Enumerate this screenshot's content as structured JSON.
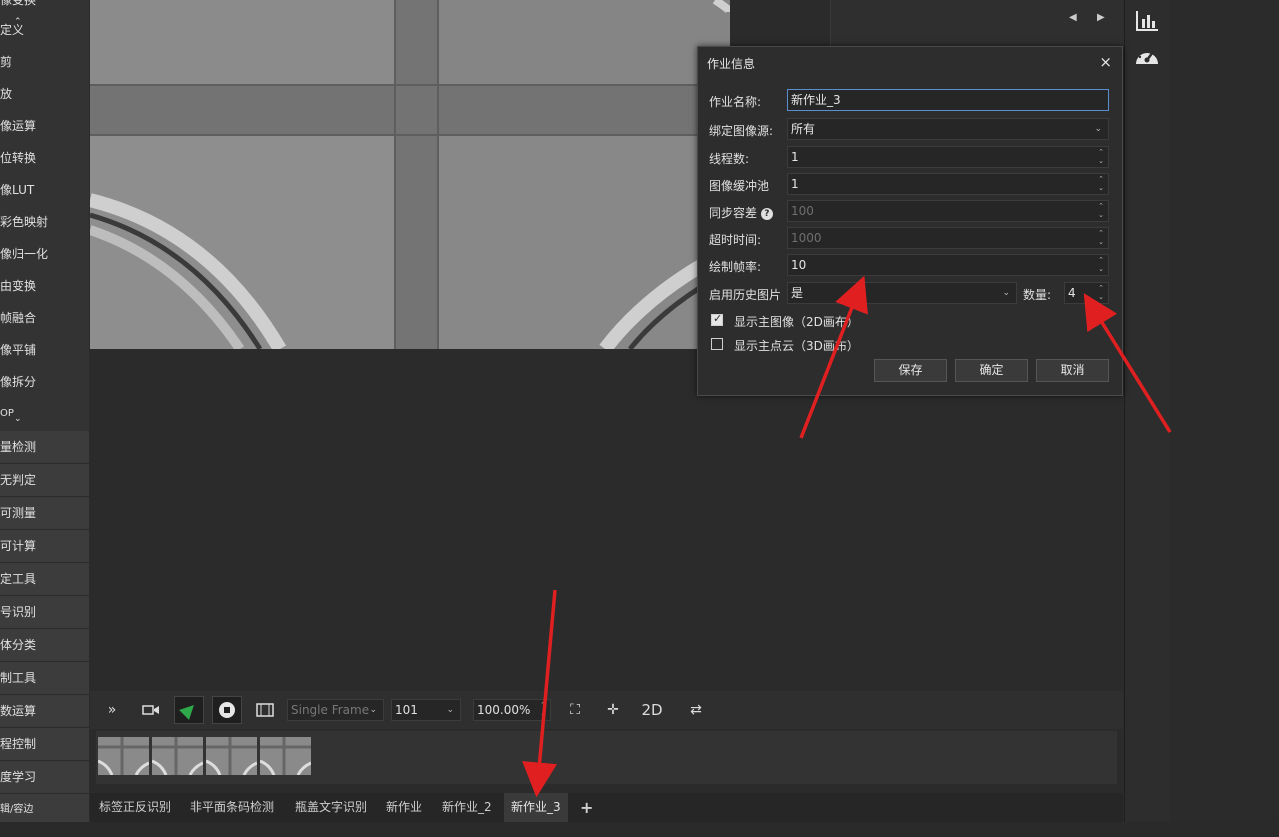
{
  "sidebar": {
    "tools": [
      "像变换",
      "定义",
      "剪",
      "放",
      "像运算",
      "位转换",
      "像LUT",
      "彩色映射",
      "像归一化",
      "由变换",
      "帧融合",
      "像平铺",
      "像拆分",
      "OP"
    ],
    "categories": [
      "量检测",
      "无判定",
      "可测量",
      "可计算",
      "定工具",
      "号识别",
      "体分类",
      "制工具",
      "数运算",
      "程控制",
      "度学习",
      "辑/容边"
    ]
  },
  "dialog": {
    "title": "作业信息",
    "close": "×",
    "fields": {
      "job_name_label": "作业名称:",
      "job_name_value": "新作业_3",
      "image_source_label": "绑定图像源:",
      "image_source_value": "所有",
      "thread_count_label": "线程数:",
      "thread_count_value": "1",
      "buffer_pool_label": "图像缓冲池",
      "buffer_pool_value": "1",
      "sync_tolerance_label": "同步容差",
      "sync_tolerance_value": "100",
      "timeout_label": "超时时间:",
      "timeout_value": "1000",
      "draw_fps_label": "绘制帧率:",
      "draw_fps_value": "10",
      "history_label": "启用历史图片",
      "history_value": "是",
      "count_label": "数量:",
      "count_value": "4"
    },
    "checkboxes": [
      {
        "label": "显示主图像（2D画布）",
        "checked": true
      },
      {
        "label": "显示主点云（3D画布）",
        "checked": false
      }
    ],
    "buttons": {
      "save": "保存",
      "ok": "确定",
      "cancel": "取消"
    }
  },
  "toolbar": {
    "mode_select": "Single Frame",
    "frame_select": "101",
    "zoom_value": "100.00%",
    "view_2d": "2D"
  },
  "tabs": [
    "标签正反识别",
    "非平面条码检测",
    "瓶盖文字识别",
    "新作业",
    "新作业_2",
    "新作业_3"
  ],
  "tabs_add": "+",
  "right_panel": {
    "nav_prev": "◀",
    "nav_next": "▶"
  },
  "colors": {
    "annotation_arrow": "#e02020",
    "accent_focus": "#5a8fd0",
    "run_green": "#2ea84a"
  }
}
